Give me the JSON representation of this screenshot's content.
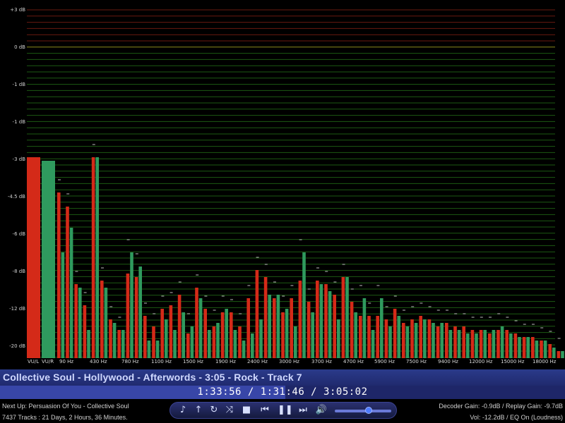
{
  "visualizer": {
    "db_labels": [
      "+3 dB",
      "0 dB",
      "-1 dB",
      "-1 dB",
      "-3 dB",
      "-4.5 dB",
      "-6 dB",
      "-8 dB",
      "-12 dB",
      "-20 dB"
    ],
    "freq_labels": [
      "VU/L",
      "VU/R",
      "90 Hz",
      "430 Hz",
      "780 Hz",
      "1100 Hz",
      "1500 Hz",
      "1900 Hz",
      "2400 Hz",
      "3000 Hz",
      "3700 Hz",
      "4700 Hz",
      "5900 Hz",
      "7500 Hz",
      "9400 Hz",
      "12000 Hz",
      "15000 Hz",
      "18000 Hz"
    ],
    "vu_levels": {
      "left": 0.57,
      "right": 0.56
    },
    "bands": [
      [
        0.47,
        0.3
      ],
      [
        0.43,
        0.37
      ],
      [
        0.21,
        0.2
      ],
      [
        0.15,
        0.08
      ],
      [
        0.57,
        0.57
      ],
      [
        0.22,
        0.2
      ],
      [
        0.11,
        0.1
      ],
      [
        0.08,
        0.08
      ],
      [
        0.24,
        0.3
      ],
      [
        0.23,
        0.26
      ],
      [
        0.12,
        0.05
      ],
      [
        0.09,
        0.05
      ],
      [
        0.14,
        0.11
      ],
      [
        0.15,
        0.08
      ],
      [
        0.18,
        0.13
      ],
      [
        0.07,
        0.09
      ],
      [
        0.2,
        0.17
      ],
      [
        0.14,
        0.08
      ],
      [
        0.09,
        0.1
      ],
      [
        0.13,
        0.14
      ],
      [
        0.13,
        0.08
      ],
      [
        0.09,
        0.05
      ],
      [
        0.17,
        0.07
      ],
      [
        0.25,
        0.11
      ],
      [
        0.23,
        0.18
      ],
      [
        0.17,
        0.18
      ],
      [
        0.13,
        0.14
      ],
      [
        0.17,
        0.09
      ],
      [
        0.22,
        0.3
      ],
      [
        0.16,
        0.13
      ],
      [
        0.22,
        0.21
      ],
      [
        0.21,
        0.19
      ],
      [
        0.18,
        0.11
      ],
      [
        0.23,
        0.23
      ],
      [
        0.16,
        0.13
      ],
      [
        0.12,
        0.17
      ],
      [
        0.12,
        0.08
      ],
      [
        0.12,
        0.17
      ],
      [
        0.11,
        0.09
      ],
      [
        0.14,
        0.12
      ],
      [
        0.1,
        0.09
      ],
      [
        0.11,
        0.1
      ],
      [
        0.12,
        0.11
      ],
      [
        0.11,
        0.1
      ],
      [
        0.09,
        0.1
      ],
      [
        0.1,
        0.08
      ],
      [
        0.09,
        0.08
      ],
      [
        0.09,
        0.07
      ],
      [
        0.08,
        0.07
      ],
      [
        0.08,
        0.08
      ],
      [
        0.07,
        0.08
      ],
      [
        0.08,
        0.09
      ],
      [
        0.08,
        0.07
      ],
      [
        0.07,
        0.06
      ],
      [
        0.06,
        0.06
      ],
      [
        0.06,
        0.05
      ],
      [
        0.05,
        0.05
      ],
      [
        0.04,
        0.03
      ],
      [
        0.02,
        0.02
      ]
    ],
    "colors": {
      "left_bar": "#d42a18",
      "right_bar": "#2f9a5e",
      "grid": "#1c5a12",
      "grid_hot": "#6a1a10",
      "grid_zero": "#8a8a1a"
    }
  },
  "song": {
    "title": "Collective Soul - Hollywood - Afterwords - 3:05 - Rock - Track 7"
  },
  "playback": {
    "time_readout": "1:33:56 / 1:31:46 / 3:05:02",
    "progress_fraction": 0.505
  },
  "info": {
    "next_up": "Next Up: Persuasion Of You - Collective Soul",
    "track_stats": "7437 Tracks : 21 Days, 2 Hours, 36 Minutes.",
    "gain": "Decoder Gain: -0.9dB / Replay Gain: -9.7dB",
    "volume_eq": "Vol: -12.2dB / EQ On (Loudness)"
  },
  "controls": {
    "icons": [
      "music-note-icon",
      "up-arrow-icon",
      "repeat-icon",
      "shuffle-icon",
      "stop-icon",
      "previous-icon",
      "pause-icon",
      "next-icon",
      "volume-icon"
    ],
    "volume_fraction": 0.6
  }
}
